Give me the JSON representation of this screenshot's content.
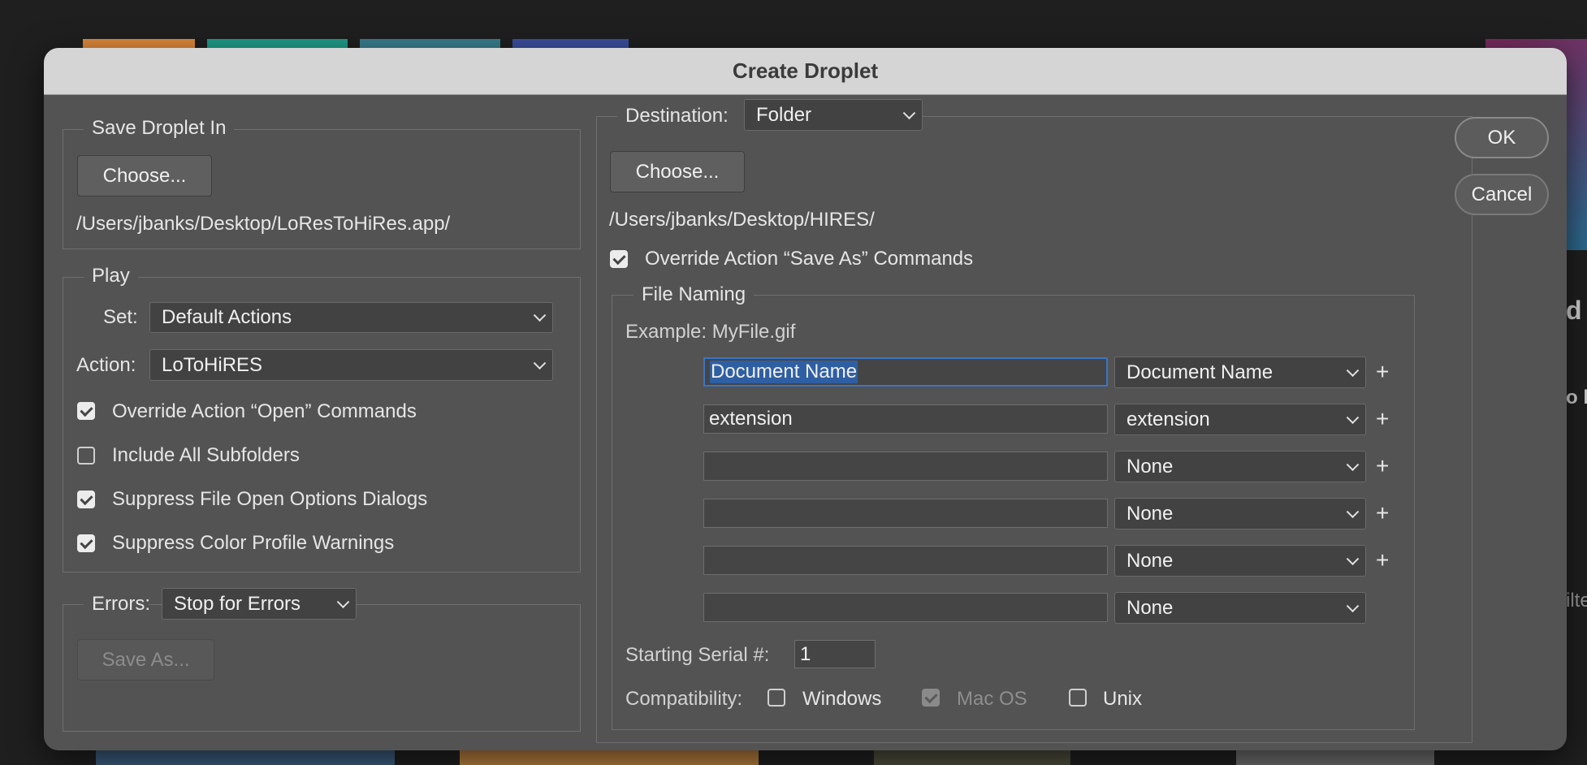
{
  "dialog": {
    "title": "Create Droplet",
    "ok_label": "OK",
    "cancel_label": "Cancel"
  },
  "save_droplet_in": {
    "legend": "Save Droplet In",
    "choose_label": "Choose...",
    "path": "/Users/jbanks/Desktop/LoResToHiRes.app/"
  },
  "play": {
    "legend": "Play",
    "set_label": "Set:",
    "set_value": "Default Actions",
    "action_label": "Action:",
    "action_value": "LoToHiRES",
    "options": [
      {
        "label": "Override Action “Open” Commands",
        "checked": true
      },
      {
        "label": "Include All Subfolders",
        "checked": false
      },
      {
        "label": "Suppress File Open Options Dialogs",
        "checked": true
      },
      {
        "label": "Suppress Color Profile Warnings",
        "checked": true
      }
    ]
  },
  "errors": {
    "label": "Errors:",
    "value": "Stop for Errors",
    "save_as_label": "Save As..."
  },
  "destination": {
    "label": "Destination:",
    "value": "Folder",
    "choose_label": "Choose...",
    "path": "/Users/jbanks/Desktop/HIRES/",
    "override_label": "Override Action “Save As” Commands",
    "override_checked": true
  },
  "file_naming": {
    "legend": "File Naming",
    "example": "Example: MyFile.gif",
    "rows": [
      {
        "text": "Document Name",
        "select": "Document Name",
        "plus": "+"
      },
      {
        "text": "extension",
        "select": "extension",
        "plus": "+"
      },
      {
        "text": "",
        "select": "None",
        "plus": "+"
      },
      {
        "text": "",
        "select": "None",
        "plus": "+"
      },
      {
        "text": "",
        "select": "None",
        "plus": "+"
      },
      {
        "text": "",
        "select": "None",
        "plus": ""
      }
    ],
    "serial_label": "Starting Serial #:",
    "serial_value": "1",
    "compat_label": "Compatibility:",
    "compat": [
      {
        "label": "Windows",
        "checked": false,
        "enabled": true
      },
      {
        "label": "Mac OS",
        "checked": true,
        "enabled": false
      },
      {
        "label": "Unix",
        "checked": false,
        "enabled": true
      }
    ]
  },
  "background_text": {
    "right_a": "d",
    "right_b": "o l",
    "right_c": "ilte"
  },
  "colors": {
    "dialog_bg": "#535353",
    "titlebar_bg": "#d5d5d5",
    "selection": "#2f5fa3",
    "focus_ring": "#3b75c4"
  }
}
